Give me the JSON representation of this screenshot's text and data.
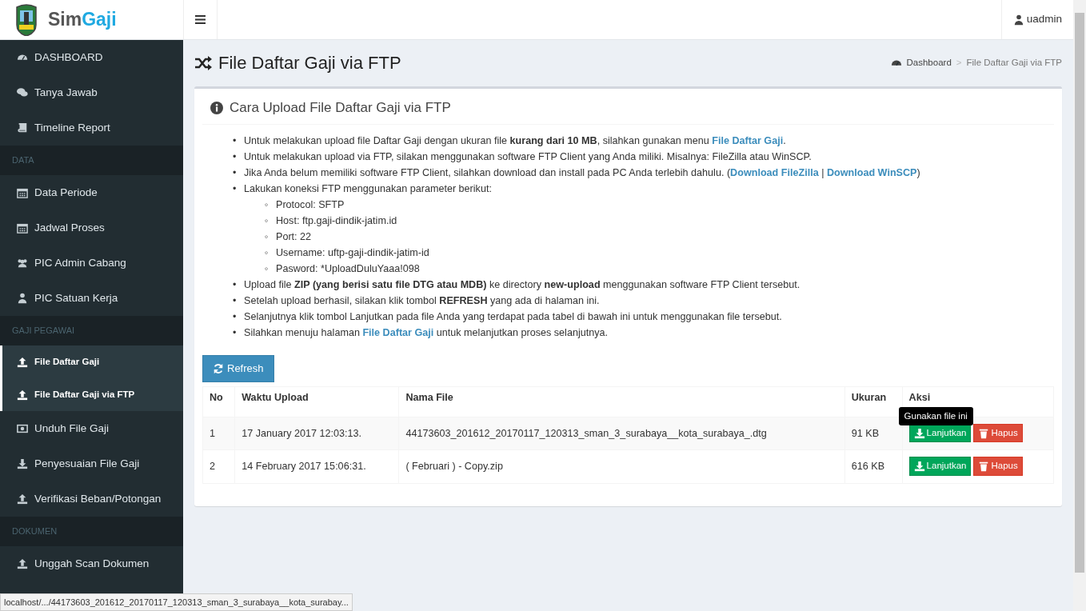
{
  "brand": {
    "first": "Sim",
    "second": "Gaji"
  },
  "user": {
    "name": "uadmin"
  },
  "sidebar": [
    {
      "kind": "item",
      "label": "DASHBOARD",
      "selected": false
    },
    {
      "kind": "item",
      "label": "Tanya Jawab",
      "selected": false
    },
    {
      "kind": "item",
      "label": "Timeline Report",
      "selected": false
    },
    {
      "kind": "header",
      "label": "DATA"
    },
    {
      "kind": "item",
      "label": "Data Periode",
      "selected": false
    },
    {
      "kind": "item",
      "label": "Jadwal Proses",
      "selected": false
    },
    {
      "kind": "item",
      "label": "PIC Admin Cabang",
      "selected": false
    },
    {
      "kind": "item",
      "label": "PIC Satuan Kerja",
      "selected": false
    },
    {
      "kind": "header",
      "label": "GAJI PEGAWAI"
    },
    {
      "kind": "item",
      "label": "File Daftar Gaji",
      "selected": true
    },
    {
      "kind": "item",
      "label": "File Daftar Gaji via FTP",
      "selected": true
    },
    {
      "kind": "item",
      "label": "Unduh File Gaji",
      "selected": false
    },
    {
      "kind": "item",
      "label": "Penyesuaian File Gaji",
      "selected": false
    },
    {
      "kind": "item",
      "label": "Verifikasi Beban/Potongan",
      "selected": false
    },
    {
      "kind": "header",
      "label": "DOKUMEN"
    },
    {
      "kind": "item",
      "label": "Unggah Scan Dokumen",
      "selected": false
    }
  ],
  "page": {
    "title": "File Daftar Gaji via FTP"
  },
  "breadcrumb": {
    "items": [
      "Dashboard",
      "File Daftar Gaji via FTP"
    ],
    "separator": ">"
  },
  "card": {
    "title": "Cara Upload File Daftar Gaji via FTP",
    "steps": [
      {
        "marker": "•",
        "parts": [
          {
            "kind": "text",
            "text": "Untuk melakukan upload file Daftar Gaji dengan ukuran file "
          },
          {
            "kind": "bold",
            "text": "kurang dari 10 MB"
          },
          {
            "kind": "text",
            "text": ", silahkan gunakan menu "
          },
          {
            "kind": "link",
            "text": "File Daftar Gaji"
          },
          {
            "kind": "text",
            "text": "."
          }
        ]
      },
      {
        "marker": "•",
        "parts": [
          {
            "kind": "text",
            "text": "Untuk melakukan upload via FTP, silakan menggunakan software FTP Client yang Anda miliki. Misalnya: FileZilla atau WinSCP."
          }
        ]
      },
      {
        "marker": "•",
        "parts": [
          {
            "kind": "text",
            "text": "Jika Anda belum memiliki software FTP Client, silahkan download dan install pada PC Anda terlebih dahulu. ("
          },
          {
            "kind": "link",
            "text": "Download FileZilla"
          },
          {
            "kind": "text",
            "text": " | "
          },
          {
            "kind": "link",
            "text": "Download WinSCP"
          },
          {
            "kind": "text",
            "text": ")"
          }
        ]
      },
      {
        "marker": "•",
        "parts": [
          {
            "kind": "text",
            "text": "Lakukan koneksi FTP menggunakan parameter berikut:"
          }
        ],
        "children": [
          {
            "marker": "◦",
            "parts": [
              {
                "kind": "text",
                "text": "Protocol: SFTP"
              }
            ]
          },
          {
            "marker": "◦",
            "parts": [
              {
                "kind": "text",
                "text": "Host: ftp.gaji-dindik-jatim.id"
              }
            ]
          },
          {
            "marker": "◦",
            "parts": [
              {
                "kind": "text",
                "text": "Port: 22"
              }
            ]
          },
          {
            "marker": "◦",
            "parts": [
              {
                "kind": "text",
                "text": "Username: uftp-gaji-dindik-jatim-id"
              }
            ]
          },
          {
            "marker": "◦",
            "parts": [
              {
                "kind": "text",
                "text": "Pasword: *UploadDuluYaaa!098"
              }
            ]
          }
        ]
      },
      {
        "marker": "•",
        "parts": [
          {
            "kind": "text",
            "text": "Upload file "
          },
          {
            "kind": "bold",
            "text": "ZIP (yang berisi satu file DTG atau MDB)"
          },
          {
            "kind": "text",
            "text": " ke directory "
          },
          {
            "kind": "bold",
            "text": "new-upload"
          },
          {
            "kind": "text",
            "text": " menggunakan software FTP Client tersebut."
          }
        ]
      },
      {
        "marker": "•",
        "parts": [
          {
            "kind": "text",
            "text": "Setelah upload berhasil, silakan klik tombol "
          },
          {
            "kind": "bold",
            "text": "REFRESH"
          },
          {
            "kind": "text",
            "text": " yang ada di halaman ini."
          }
        ]
      },
      {
        "marker": "•",
        "parts": [
          {
            "kind": "text",
            "text": "Selanjutnya klik tombol Lanjutkan pada file Anda yang terdapat pada tabel di bawah ini untuk menggunakan file tersebut."
          }
        ]
      },
      {
        "marker": "•",
        "parts": [
          {
            "kind": "text",
            "text": "Silahkan menuju halaman "
          },
          {
            "kind": "link",
            "text": "File Daftar Gaji"
          },
          {
            "kind": "text",
            "text": " untuk melanjutkan proses selanjutnya."
          }
        ]
      }
    ],
    "refresh_button": "Refresh",
    "table": {
      "columns": [
        "No",
        "Waktu Upload",
        "Nama File",
        "Ukuran",
        "Aksi"
      ],
      "rows": [
        {
          "cells": [
            "1",
            "17 January 2017 12:03:13.",
            "44173603_201612_20170117_120313_sman_3_surabaya__kota_surabaya_.dtg",
            "91 KB"
          ],
          "actions": [
            "Lanjutkan",
            "Hapus"
          ]
        },
        {
          "cells": [
            "2",
            "14 February 2017 15:06:31.",
            "( Februari ) - Copy.zip",
            "616 KB"
          ],
          "actions": [
            "Lanjutkan",
            "Hapus"
          ]
        }
      ]
    },
    "tooltip": "Gunakan file ini"
  },
  "status_bar": "localhost/.../44173603_201612_20170117_120313_sman_3_surabaya__kota_surabay..."
}
